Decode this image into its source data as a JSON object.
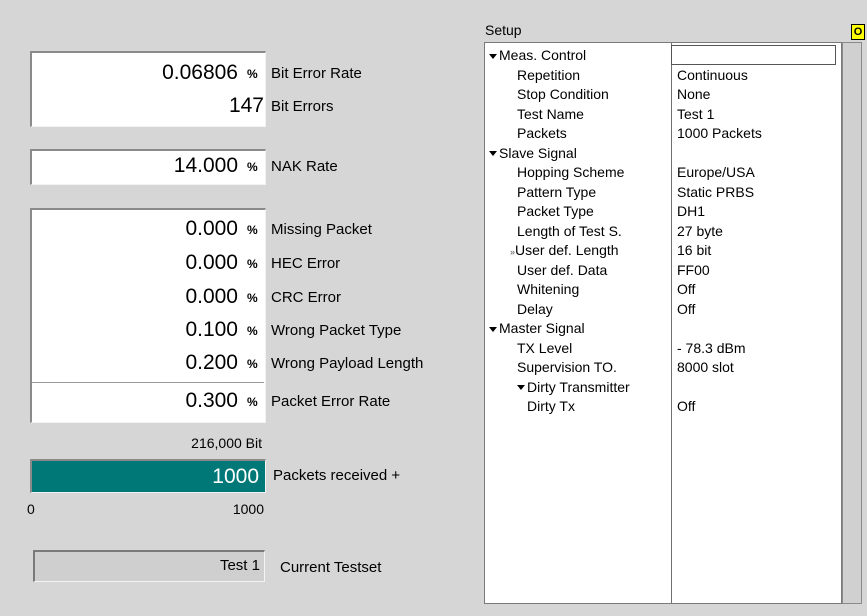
{
  "results": {
    "bit_error_rate": {
      "value": "0.06806",
      "unit": "%",
      "label": "Bit Error Rate"
    },
    "bit_errors": {
      "value": "147",
      "label": "Bit Errors"
    },
    "nak_rate": {
      "value": "14.000",
      "unit": "%",
      "label": "NAK Rate"
    },
    "missing_packet": {
      "value": "0.000",
      "unit": "%",
      "label": "Missing Packet"
    },
    "hec_error": {
      "value": "0.000",
      "unit": "%",
      "label": "HEC Error"
    },
    "crc_error": {
      "value": "0.000",
      "unit": "%",
      "label": "CRC Error"
    },
    "wrong_packet_type": {
      "value": "0.100",
      "unit": "%",
      "label": "Wrong Packet Type"
    },
    "wrong_payload_length": {
      "value": "0.200",
      "unit": "%",
      "label": "Wrong Payload Length"
    },
    "packet_error_rate": {
      "value": "0.300",
      "unit": "%",
      "label": "Packet Error Rate"
    }
  },
  "progress": {
    "bits": "216,000 Bit",
    "value": "1000",
    "label": "Packets received +",
    "min": "0",
    "max": "1000",
    "fraction": 1.0
  },
  "testset": {
    "value": "Test 1",
    "label": "Current Testset"
  },
  "setup": {
    "title": "Setup",
    "rows": [
      {
        "key": "Meas. Control",
        "value": "",
        "expanded": true,
        "level": 0
      },
      {
        "key": "Repetition",
        "value": "Continuous",
        "level": 1
      },
      {
        "key": "Stop Condition",
        "value": "None",
        "level": 1
      },
      {
        "key": "Test Name",
        "value": "Test 1",
        "level": 1
      },
      {
        "key": "Packets",
        "value": "1000 Packets",
        "level": 1
      },
      {
        "key": "Slave Signal",
        "value": "",
        "expanded": true,
        "level": 0
      },
      {
        "key": "Hopping Scheme",
        "value": "Europe/USA",
        "level": 1
      },
      {
        "key": "Pattern Type",
        "value": "Static PRBS",
        "level": 1
      },
      {
        "key": "Packet Type",
        "value": "DH1",
        "level": 1
      },
      {
        "key": "Length of Test S.",
        "value": "27 byte",
        "level": 1
      },
      {
        "key": "User def. Length",
        "value": "16  bit",
        "level": 1,
        "marker": "»"
      },
      {
        "key": "User def. Data",
        "value": "FF00",
        "level": 1
      },
      {
        "key": "Whitening",
        "value": "Off",
        "level": 1
      },
      {
        "key": "Delay",
        "value": "Off",
        "level": 1
      },
      {
        "key": "Master Signal",
        "value": "",
        "expanded": true,
        "level": 0
      },
      {
        "key": "TX Level",
        "value": "- 78.3  dBm",
        "level": 1
      },
      {
        "key": "Supervision TO.",
        "value": "8000  slot",
        "level": 1
      },
      {
        "key": "Dirty Transmitter",
        "value": "",
        "expanded": true,
        "level": 1
      },
      {
        "key": "Dirty Tx",
        "value": "Off",
        "level": 2
      }
    ]
  },
  "corner_indicator": "O",
  "colors": {
    "progress_fill": "#007878",
    "indicator": "#ffff00"
  }
}
